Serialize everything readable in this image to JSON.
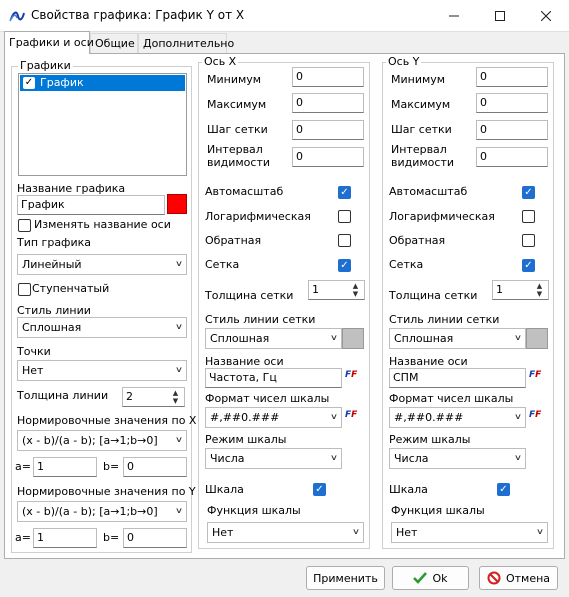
{
  "window": {
    "title": "Свойства графика: График Y от X",
    "minimize_icon": "minimize-icon",
    "maximize_icon": "maximize-icon",
    "close_icon": "close-icon",
    "app_icon": "chart-app-icon"
  },
  "tabs": [
    {
      "label": "Графики и оси"
    },
    {
      "label": "Общие"
    },
    {
      "label": "Дополнительно"
    }
  ],
  "graphs": {
    "legend": "Графики",
    "items": [
      {
        "label": "График",
        "checked": true
      }
    ],
    "name_label": "Название графика",
    "name_value": "График",
    "color": "#ff0000",
    "rename_axis_label": "Изменять название оси",
    "rename_axis_checked": false,
    "type_label": "Тип графика",
    "type_value": "Линейный",
    "stepped_label": "Ступенчатый",
    "stepped_checked": false,
    "line_style_label": "Стиль линии",
    "line_style_value": "Сплошная",
    "points_label": "Точки",
    "points_value": "Нет",
    "line_width_label": "Толщина линии",
    "line_width_value": "2",
    "norm_x_label": "Нормировочные значения по X",
    "norm_x_value": "(x - b)/(a - b);  [a→1;b→0]",
    "norm_x_a_label": "a=",
    "norm_x_a": "1",
    "norm_x_b_label": "b=",
    "norm_x_b": "0",
    "norm_y_label": "Нормировочные значения по Y",
    "norm_y_value": "(x - b)/(a - b);  [a→1;b→0]",
    "norm_y_a_label": "a=",
    "norm_y_a": "1",
    "norm_y_b_label": "b=",
    "norm_y_b": "0"
  },
  "axis_x": {
    "legend": "Ось X",
    "min_label": "Минимум",
    "min": "0",
    "max_label": "Максимум",
    "max": "0",
    "step_label": "Шаг сетки",
    "step": "0",
    "interval_label_1": "Интервал",
    "interval_label_2": "видимости",
    "interval": "0",
    "autoscale_label": "Автомасштаб",
    "autoscale": true,
    "log_label": "Логарифмическая",
    "log": false,
    "inverse_label": "Обратная",
    "inverse": false,
    "grid_label": "Сетка",
    "grid": true,
    "grid_width_label": "Толщина  сетки",
    "grid_width": "1",
    "grid_style_label": "Стиль линии сетки",
    "grid_style": "Сплошная",
    "grid_color": "#c0c0c0",
    "name_label": "Название оси",
    "name_value": "Частота, Гц",
    "format_label": "Формат чисел шкалы",
    "format_value": "#,##0.###",
    "scale_mode_label": "Режим шкалы",
    "scale_mode": "Числа",
    "scale_label": "Шкала",
    "scale": true,
    "scale_func_label": "Функция шкалы",
    "scale_func": "Нет"
  },
  "axis_y": {
    "legend": "Ось Y",
    "min_label": "Минимум",
    "min": "0",
    "max_label": "Максимум",
    "max": "0",
    "step_label": "Шаг сетки",
    "step": "0",
    "interval_label_1": "Интервал",
    "interval_label_2": "видимости",
    "interval": "0",
    "autoscale_label": "Автомасштаб",
    "autoscale": true,
    "log_label": "Логарифмическая",
    "log": false,
    "inverse_label": "Обратная",
    "inverse": false,
    "grid_label": "Сетка",
    "grid": true,
    "grid_width_label": "Толщина  сетки",
    "grid_width": "1",
    "grid_style_label": "Стиль линии сетки",
    "grid_style": "Сплошная",
    "grid_color": "#c0c0c0",
    "name_label": "Название оси",
    "name_value": "СПМ",
    "format_label": "Формат чисел шкалы",
    "format_value": "#,##0.###",
    "scale_mode_label": "Режим шкалы",
    "scale_mode": "Числа",
    "scale_label": "Шкала",
    "scale": true,
    "scale_func_label": "Функция шкалы",
    "scale_func": "Нет"
  },
  "font_button": {
    "f": "F",
    "r": "F"
  },
  "footer": {
    "apply_label": "Применить",
    "ok_label": "Ok",
    "ok_icon": "checkmark-icon",
    "cancel_label": "Отмена",
    "cancel_icon": "cancel-icon",
    "ok_color": "#2e9a2e",
    "cancel_color": "#d02020"
  }
}
